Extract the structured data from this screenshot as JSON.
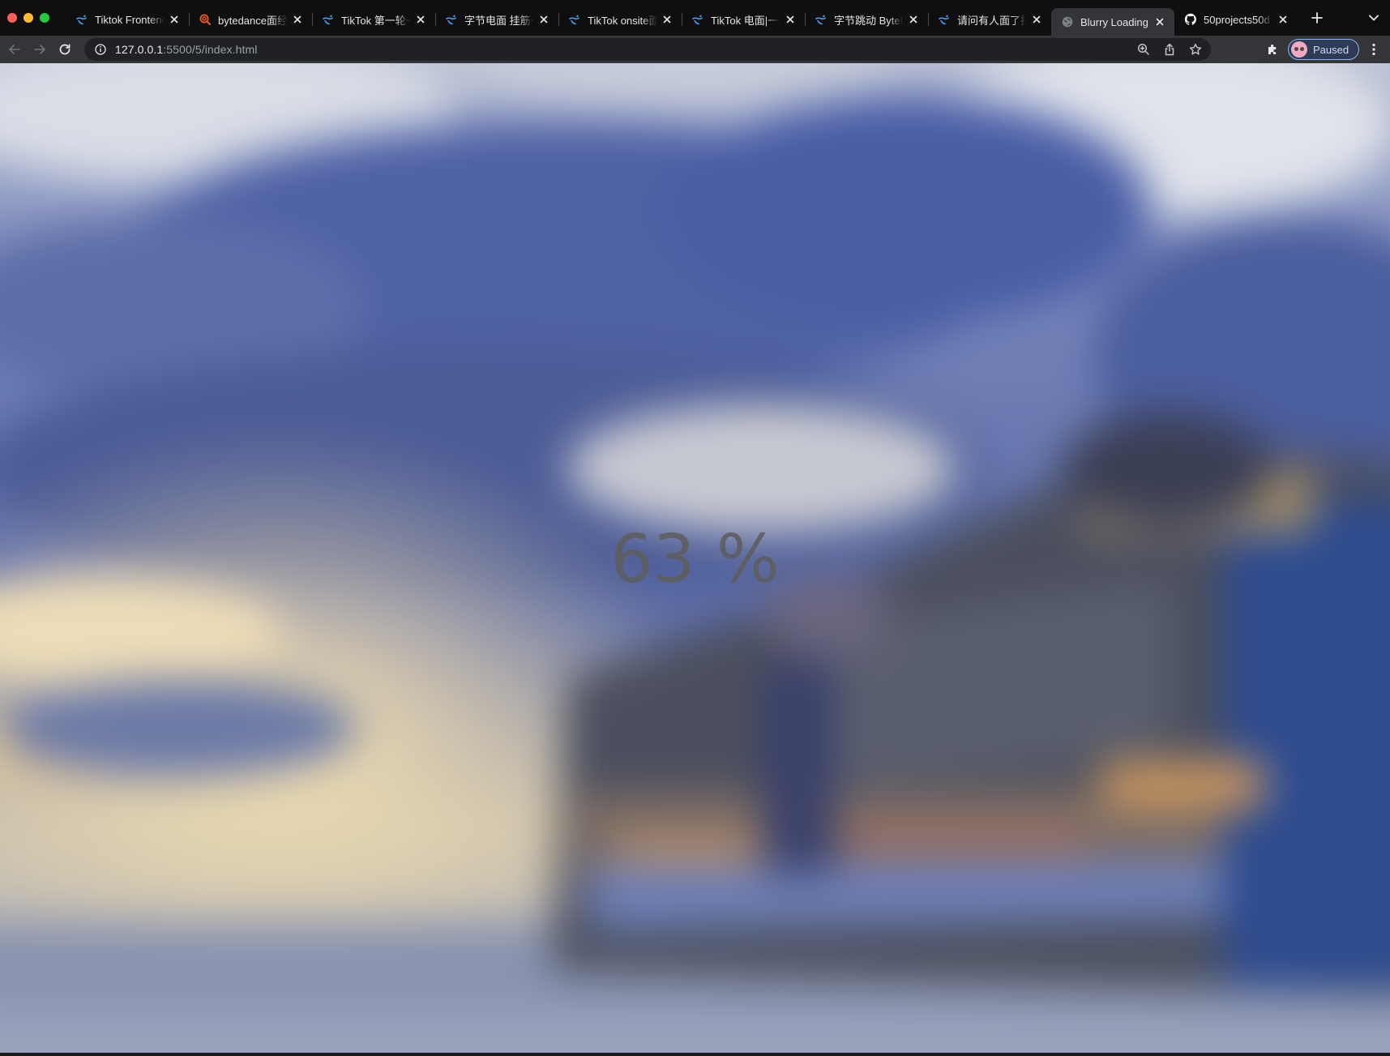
{
  "browser": {
    "tabs": [
      {
        "title": "Tiktok Frontend",
        "favicon": "tiktok-bird-icon",
        "active": false
      },
      {
        "title": "bytedance面经",
        "favicon": "search-swirl-icon",
        "active": false
      },
      {
        "title": "TikTok 第一轮一",
        "favicon": "tiktok-bird-icon",
        "active": false
      },
      {
        "title": "字节电面 挂筋一",
        "favicon": "tiktok-bird-icon",
        "active": false
      },
      {
        "title": "TikTok onsite面",
        "favicon": "tiktok-bird-icon",
        "active": false
      },
      {
        "title": "TikTok 电面|一面",
        "favicon": "tiktok-bird-icon",
        "active": false
      },
      {
        "title": "字节跳动 ByteD",
        "favicon": "tiktok-bird-icon",
        "active": false
      },
      {
        "title": "请问有人面了抖",
        "favicon": "tiktok-bird-icon",
        "active": false
      },
      {
        "title": "Blurry Loading",
        "favicon": "globe-icon",
        "active": true
      },
      {
        "title": "50projects50d",
        "favicon": "github-icon",
        "active": false
      }
    ],
    "url_host": "127.0.0.1",
    "url_path": ":5500/5/index.html",
    "profile_label": "Paused"
  },
  "page": {
    "loading_value": 63,
    "loading_text": "63 %"
  },
  "colors": {
    "tabbar_bg": "#0f0f10",
    "toolbar_bg": "#343538",
    "omnibox_bg": "#202124",
    "profile_border": "#8ab4f8"
  }
}
